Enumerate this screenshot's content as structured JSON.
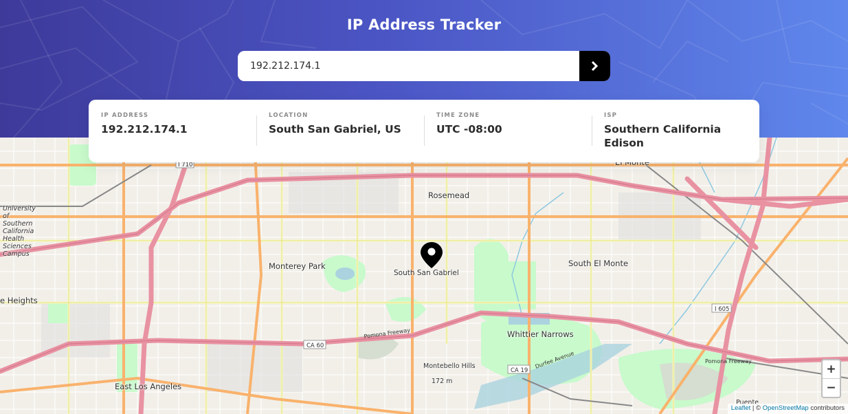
{
  "header": {
    "title": "IP Address Tracker"
  },
  "search": {
    "value": "192.212.174.1",
    "submit_icon": "chevron-right-icon"
  },
  "info": {
    "ip": {
      "label": "IP ADDRESS",
      "value": "192.212.174.1"
    },
    "location": {
      "label": "LOCATION",
      "value": "South San Gabriel, US"
    },
    "timezone": {
      "label": "TIME ZONE",
      "value": "UTC -08:00"
    },
    "isp": {
      "label": "ISP",
      "value": "Southern California Edison"
    }
  },
  "map": {
    "places": {
      "rosemead": "Rosemead",
      "monterey_park": "Monterey Park",
      "south_san_gabriel": "South San Gabriel",
      "south_el_monte": "South El Monte",
      "whittier_narrows": "Whittier Narrows",
      "east_los_angeles": "East Los Angeles",
      "montebello_hills": "Montebello Hills",
      "montebello_height": "172 m",
      "el_monte": "El Monte",
      "heights": "e Heights",
      "usc": "University of Southern California Health Sciences Campus",
      "puente": "Puente"
    },
    "road_labels": {
      "ca60": "CA 60",
      "ca19": "CA 19",
      "i605": "I 605",
      "i710": "I 710",
      "pomona_freeway": "Pomona Freeway",
      "durfee": "Durfee Avenue"
    },
    "zoom_in": "+",
    "zoom_out": "−",
    "attribution": {
      "leaflet": "Leaflet",
      "separator": " | © ",
      "osm": "OpenStreetMap",
      "suffix": " contributors"
    },
    "marker_icon": "location-pin-icon"
  },
  "colors": {
    "header_start": "#3d3a9a",
    "header_end": "#5f87ec",
    "button": "#000000",
    "freeway": "#e892a2",
    "primary_road": "#f9b26c",
    "secondary_road": "#f7fabf",
    "park": "#c8facc",
    "water": "#aad3df",
    "land": "#f2efe9"
  }
}
